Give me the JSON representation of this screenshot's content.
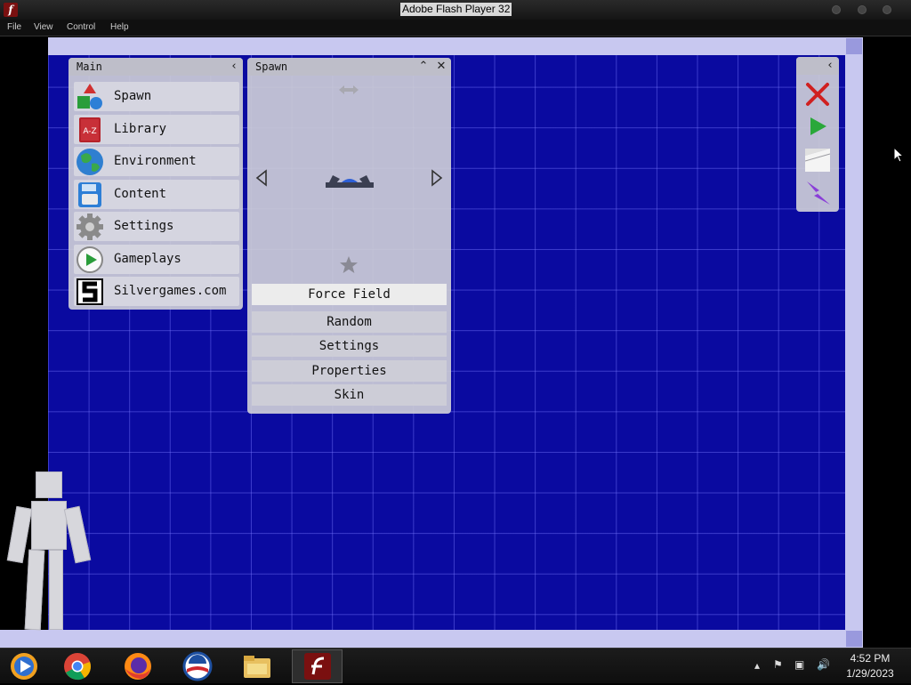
{
  "window": {
    "title": "Adobe Flash Player 32"
  },
  "menu": [
    "File",
    "View",
    "Control",
    "Help"
  ],
  "main_panel": {
    "title": "Main",
    "items": [
      {
        "label": "Spawn",
        "icon": "shapes-icon"
      },
      {
        "label": "Library",
        "icon": "book-icon"
      },
      {
        "label": "Environment",
        "icon": "globe-icon"
      },
      {
        "label": "Content",
        "icon": "floppy-disk-icon"
      },
      {
        "label": "Settings",
        "icon": "gear-icon"
      },
      {
        "label": "Gameplays",
        "icon": "play-circle-icon"
      },
      {
        "label": "Silvergames.com",
        "icon": "silvergames-logo-icon"
      }
    ],
    "library_badge": "A-Z"
  },
  "spawn_panel": {
    "title": "Spawn",
    "selected": "Force Field",
    "options": [
      "Random",
      "Settings",
      "Properties",
      "Skin"
    ]
  },
  "toolbar": {
    "tools": [
      "delete-x-icon",
      "play-icon",
      "slope-icon",
      "lightning-icon"
    ]
  },
  "taskbar": {
    "apps": [
      "windows-media-icon",
      "chrome-icon",
      "firefox-icon",
      "obama-logo-icon",
      "file-explorer-icon",
      "flash-player-icon"
    ],
    "time": "4:52 PM",
    "date": "1/29/2023"
  },
  "colors": {
    "grid_bg": "#0a0aa0",
    "rail": "#c8c8f0",
    "panel": "#cdcdd7",
    "flash_red": "#7a1010"
  }
}
